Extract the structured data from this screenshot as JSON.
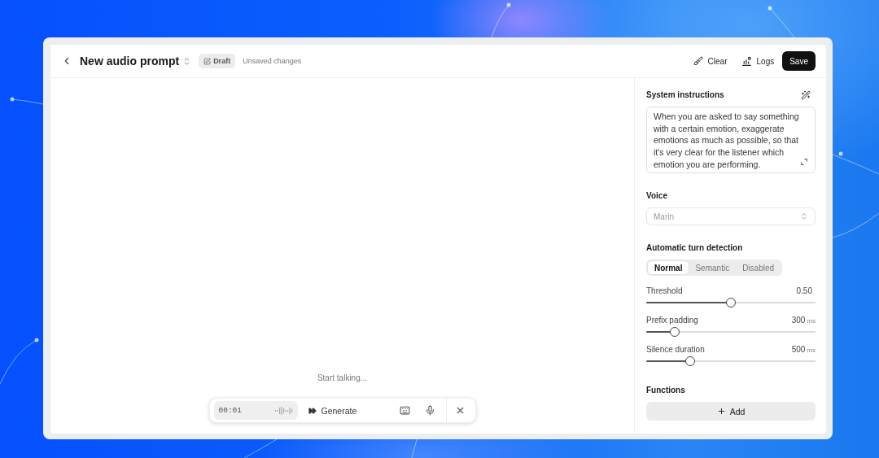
{
  "header": {
    "title": "New audio prompt",
    "badge": "Draft",
    "status": "Unsaved changes",
    "actions": [
      {
        "label": "Clear",
        "kind": "ghost"
      },
      {
        "label": "Logs",
        "kind": "ghost"
      },
      {
        "label": "Save",
        "kind": "primary"
      }
    ]
  },
  "canvas": {
    "hint": "Start talking...",
    "toolbar": {
      "timer": "00:01",
      "action": "Generate"
    }
  },
  "sidebar": {
    "instructions": {
      "label": "System instructions",
      "value": "When you are asked to say something with a certain emotion, exaggerate emotions as much as possible, so that it's very clear for the listener which emotion you are performing."
    },
    "voice": {
      "label": "Voice",
      "value": "Marin",
      "disabled": true
    },
    "turn_detection": {
      "label": "Automatic turn detection",
      "modes": [
        {
          "label": "Normal",
          "selected": true
        },
        {
          "label": "Semantic",
          "selected": false
        },
        {
          "label": "Disabled",
          "selected": false
        }
      ]
    },
    "sliders": [
      {
        "label": "Threshold",
        "value": "0.50",
        "level": 0.5
      },
      {
        "label": "Prefix padding",
        "value": "300",
        "unit": "ms",
        "level": 0.17
      },
      {
        "label": "Silence duration",
        "value": "500",
        "unit": "ms",
        "level": 0.26
      }
    ],
    "functions": {
      "label": "Functions",
      "button": "Add"
    }
  }
}
